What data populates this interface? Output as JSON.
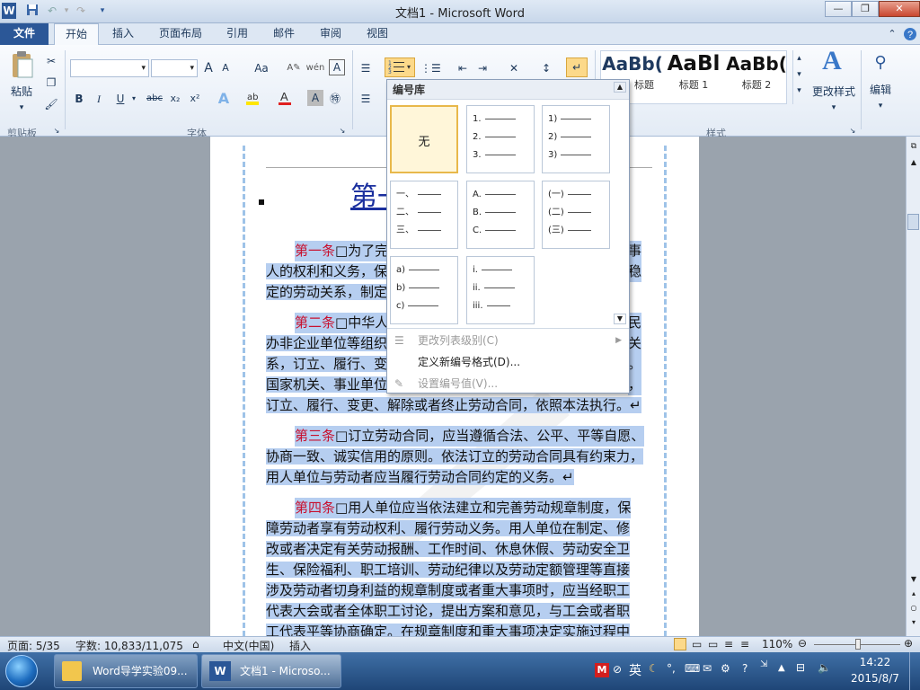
{
  "window": {
    "title": "文档1  -  Microsoft Word",
    "app_logo": "W",
    "controls": {
      "minimize": "—",
      "restore": "❐",
      "close": "✕"
    }
  },
  "tabs": [
    {
      "label": "文件"
    },
    {
      "label": "开始"
    },
    {
      "label": "插入"
    },
    {
      "label": "页面布局"
    },
    {
      "label": "引用"
    },
    {
      "label": "邮件"
    },
    {
      "label": "审阅"
    },
    {
      "label": "视图"
    }
  ],
  "ribbon": {
    "clipboard": {
      "paste_label": "粘贴",
      "group_label": "剪贴板"
    },
    "font": {
      "group_label": "字体",
      "bold": "B",
      "italic": "I",
      "underline": "U",
      "strike": "abc",
      "sub": "x₂",
      "sup": "x²",
      "grow": "A",
      "shrink": "A",
      "case": "Aa",
      "clear": "A",
      "char_border": "A"
    },
    "styles": {
      "group_label": "样式",
      "items": [
        {
          "preview": "AaBb(",
          "label": "标题"
        },
        {
          "preview": "AaBl",
          "label": "标题 1"
        },
        {
          "preview": "AaBb(",
          "label": "标题 2"
        }
      ],
      "change_styles": "更改样式",
      "change_styles_icon": "A"
    },
    "edit": {
      "label": "编辑"
    }
  },
  "numbering_dropdown": {
    "header": "编号库",
    "none_label": "无",
    "formats": [
      [
        "1.",
        "2.",
        "3."
      ],
      [
        "1)",
        "2)",
        "3)"
      ],
      [
        "一、",
        "二、",
        "三、"
      ],
      [
        "A.",
        "B.",
        "C."
      ],
      [
        "(一)",
        "(二)",
        "(三)"
      ],
      [
        "a)",
        "b)",
        "c)"
      ],
      [
        "i.",
        "ii.",
        "iii."
      ]
    ],
    "menu": [
      {
        "label": "更改列表级别(C)",
        "enabled": false
      },
      {
        "label": "定义新编号格式(D)...",
        "enabled": true
      },
      {
        "label": "设置编号值(V)...",
        "enabled": false
      }
    ]
  },
  "document": {
    "heading_fragment": "第一",
    "paragraphs": [
      {
        "lead": "第一条",
        "lines": [
          "□为了完",
          "事",
          "人的权利和义务，保",
          "稳",
          "定的劳动关系，制定"
        ]
      },
      {
        "lead": "第二条",
        "lines": [
          "□中华人",
          "民",
          "办非企业单位等组织",
          "关",
          "系，订立、履行、变",
          "。",
          "国家机关、事业单位",
          "，",
          "订立、履行、变更、解除或者终止劳动合同，依照本法执行。↵"
        ]
      },
      {
        "lead": "第三条",
        "lines": [
          "□订立劳动合同，应当遵循合法、公平、平等自愿、",
          "协商一致、诚实信用的原则。依法订立的劳动合同具有约束力，",
          "用人单位与劳动者应当履行劳动合同约定的义务。↵"
        ]
      },
      {
        "lead": "第四条",
        "lines": [
          "□用人单位应当依法建立和完善劳动规章制度，保",
          "障劳动者享有劳动权利、履行劳动义务。用人单位在制定、修",
          "改或者决定有关劳动报酬、工作时间、休息休假、劳动安全卫",
          "生、保险福利、职工培训、劳动纪律以及劳动定额管理等直接",
          "涉及劳动者切身利益的规章制度或者重大事项时，应当经职工",
          "代表大会或者全体职工讨论，提出方案和意见，与工会或者职",
          "工代表平等协商确定。在规章制度和重大事项决定实施过程中"
        ]
      }
    ]
  },
  "status": {
    "page": "页面: 5/35",
    "words": "字数: 10,833/11,075",
    "language": "中文(中国)",
    "insert": "插入",
    "zoom": "110%"
  },
  "taskbar": {
    "items": [
      {
        "label": "Word导学实验09..."
      },
      {
        "label": "文档1 - Microso..."
      }
    ],
    "ime": "英",
    "time": "14:22",
    "date": "2015/8/7"
  }
}
